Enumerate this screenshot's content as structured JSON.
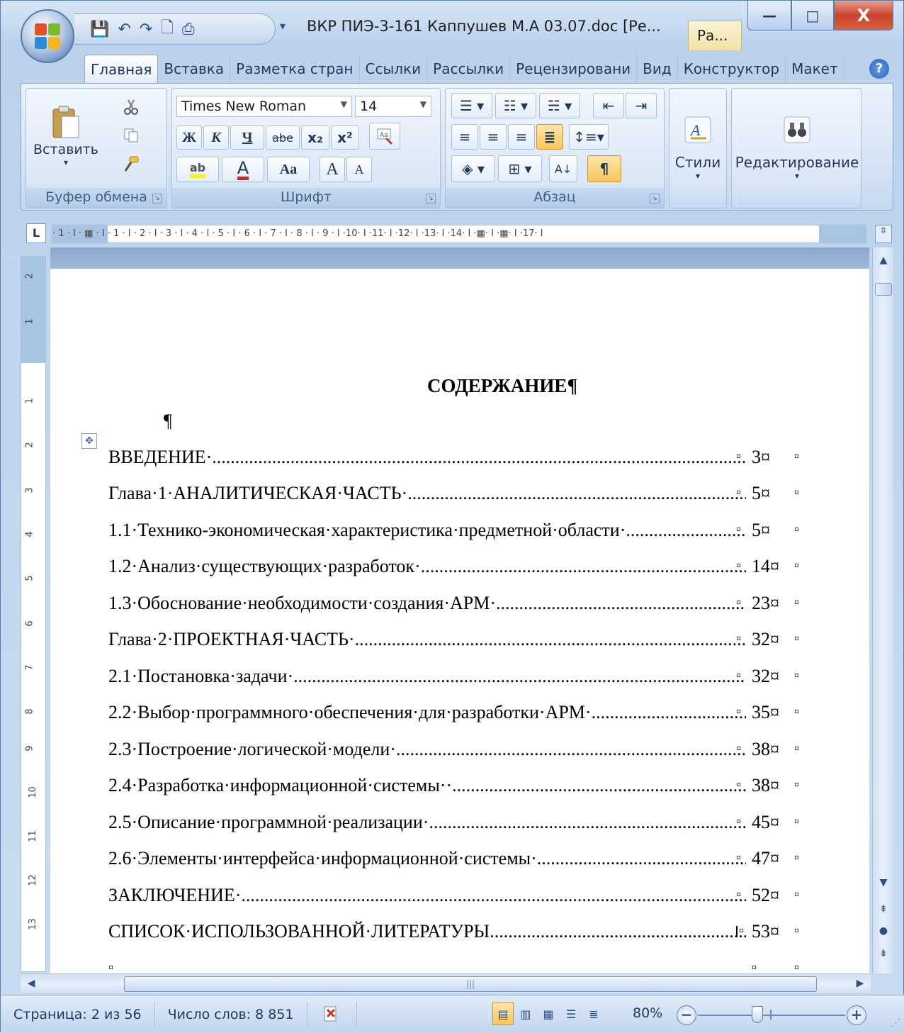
{
  "window": {
    "title": "ВКР ПИЭ-3-161 Каппушев М.А 03.07.doc [Ре...",
    "context_tab": "Ра...",
    "controls": {
      "minimize": "—",
      "maximize": "□",
      "close": "X"
    }
  },
  "qat": {
    "save": "💾",
    "undo": "↶",
    "redo": "↷",
    "new": "🗋",
    "print": "⎙",
    "more": "▾"
  },
  "tabs": [
    "Главная",
    "Вставка",
    "Разметка стран",
    "Ссылки",
    "Рассылки",
    "Рецензировани",
    "Вид",
    "Конструктор",
    "Макет"
  ],
  "help": "?",
  "ribbon": {
    "clipboard": {
      "label": "Буфер обмена",
      "paste": "Вставить",
      "paste_arrow": "▾"
    },
    "font": {
      "label": "Шрифт",
      "font_name": "Times New Roman",
      "font_size": "14",
      "bold": "Ж",
      "italic": "К",
      "underline": "Ч",
      "strike": "abe",
      "subscript": "x₂",
      "superscript": "x²",
      "highlight": "ab",
      "font_color": "A",
      "case": "Aa",
      "grow": "A",
      "shrink": "A"
    },
    "paragraph": {
      "label": "Абзац",
      "pilcrow": "¶"
    },
    "styles": {
      "label": "Стили"
    },
    "editing": {
      "label": "Редактирование"
    }
  },
  "ruler": {
    "corner": "L",
    "ticks": "· 1 · I · ▦ · I · 1 · I · 2 · I · 3 · I · 4 · I · 5 · I · 6 · I · 7 · I · 8 · I · 9 · I ·10· I ·11· I ·12· I ·13· I ·14· I ·▦· I ·▦· I ·17· I",
    "vertical_ticks": [
      "2",
      "1",
      "1",
      "2",
      "3",
      "4",
      "5",
      "6",
      "7",
      "8",
      "9",
      "10",
      "11",
      "12",
      "13"
    ]
  },
  "document": {
    "title": "СОДЕРЖАНИЕ¶",
    "empty_para": "¶",
    "table_handle": "✥",
    "end_cell": "¤",
    "toc": [
      {
        "text": "ВВЕДЕНИЕ·",
        "page": "3¤"
      },
      {
        "text": "Глава·1·АНАЛИТИЧЕСКАЯ·ЧАСТЬ·",
        "page": "5¤"
      },
      {
        "text": "1.1·Технико-экономическая·характеристика·предметной·области·",
        "page": "5¤"
      },
      {
        "text": "1.2·Анализ·существующих·разработок·",
        "page": "14¤"
      },
      {
        "text": "1.3·Обоснование·необходимости·создания·АРМ·",
        "page": "23¤"
      },
      {
        "text": "Глава·2·ПРОЕКТНАЯ·ЧАСТЬ·",
        "page": "32¤"
      },
      {
        "text": "2.1·Постановка·задачи·",
        "page": "32¤"
      },
      {
        "text": "2.2·Выбор·программного·обеспечения·для·разработки·АРМ·",
        "page": "35¤"
      },
      {
        "text": "2.3·Построение·логической·модели·",
        "page": "38¤"
      },
      {
        "text": "2.4·Разработка·информационной·системы··",
        "page": "38¤"
      },
      {
        "text": "2.5·Описание·программной·реализации·",
        "page": "45¤"
      },
      {
        "text": "2.6·Элементы·интерфейса·информационной·системы·",
        "page": "47¤"
      },
      {
        "text": "ЗАКЛЮЧЕНИЕ·",
        "page": "52¤"
      },
      {
        "text": "СПИСОК·ИСПОЛЬЗОВАННОЙ·ЛИТЕРАТУРЫ",
        "page": "53¤"
      },
      {
        "text": "¤",
        "page": "¤"
      }
    ]
  },
  "statusbar": {
    "page": "Страница: 2 из 56",
    "words": "Число слов: 8 851",
    "zoom": "80%",
    "zoom_out": "−",
    "zoom_in": "+"
  },
  "colors": {
    "accent": "#c4d6ec",
    "active_button": "#f8c65c",
    "close_button": "#c9442a"
  }
}
